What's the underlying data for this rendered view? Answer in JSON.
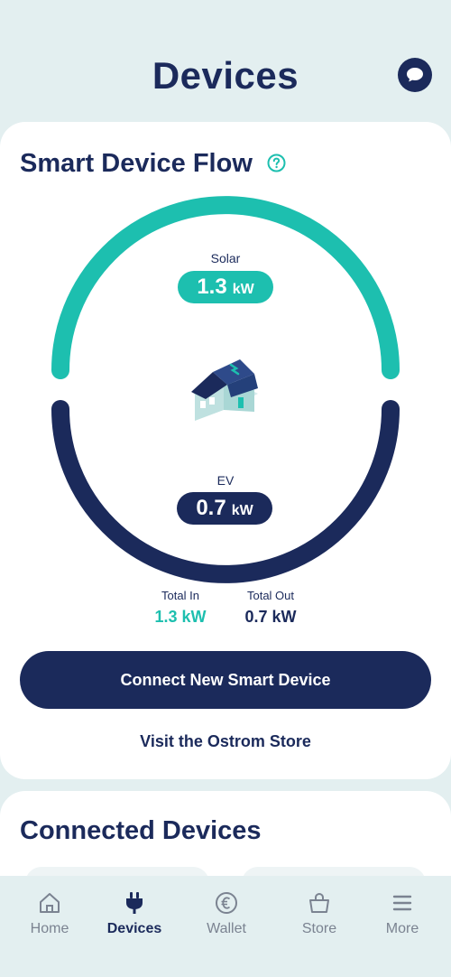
{
  "header": {
    "title": "Devices",
    "chat_icon": "chat-bubble-icon"
  },
  "flow_card": {
    "title": "Smart Device Flow",
    "help_icon": "question-circle-icon",
    "solar": {
      "label": "Solar",
      "value": "1.3",
      "unit": "kW"
    },
    "ev": {
      "label": "EV",
      "value": "0.7",
      "unit": "kW"
    },
    "house_icon": "house-illustration-icon",
    "totals": {
      "in_label": "Total In",
      "in_value": "1.3 kW",
      "out_label": "Total Out",
      "out_value": "0.7 kW"
    },
    "connect_button": "Connect New Smart Device",
    "store_link": "Visit the Ostrom Store"
  },
  "connected": {
    "title": "Connected Devices"
  },
  "tabbar": {
    "tabs": [
      {
        "label": "Home",
        "icon": "home-icon"
      },
      {
        "label": "Devices",
        "icon": "plug-icon",
        "active": true
      },
      {
        "label": "Wallet",
        "icon": "euro-coin-icon"
      },
      {
        "label": "Store",
        "icon": "shopping-bag-icon"
      },
      {
        "label": "More",
        "icon": "menu-icon"
      }
    ]
  },
  "colors": {
    "accent_teal": "#1DBFAF",
    "navy": "#1B2A5B",
    "background": "#E3EFF0"
  }
}
